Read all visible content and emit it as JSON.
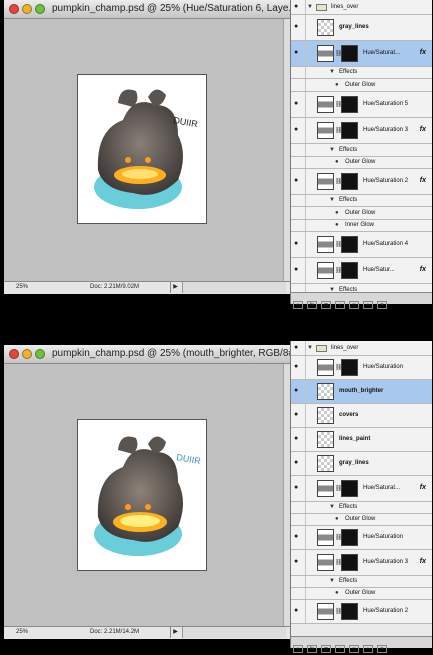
{
  "window1": {
    "title": "pumpkin_champ.psd @ 25% (Hue/Saturation 6, Laye...",
    "zoom": "25%",
    "doc_info": "Doc: 2.21M/9.02M",
    "sketch_text": "DUIIR"
  },
  "window2": {
    "title": "pumpkin_champ.psd @ 25% (mouth_brighter, RGB/8#)",
    "zoom": "25%",
    "doc_info": "Doc: 2.21M/14.2M",
    "sketch_text": "DUIIR"
  },
  "panel1": {
    "rows": [
      {
        "kind": "group",
        "name": "lines_over"
      },
      {
        "kind": "layer",
        "name": "gray_lines"
      },
      {
        "kind": "layer",
        "name": "Hue/Saturat...",
        "fx": "fx"
      },
      {
        "kind": "sub",
        "name": "Effects"
      },
      {
        "kind": "sub2",
        "name": "Outer Glow"
      },
      {
        "kind": "layer",
        "name": "Hue/Saturation 5"
      },
      {
        "kind": "layer",
        "name": "Hue/Saturation 3",
        "fx": "fx"
      },
      {
        "kind": "sub",
        "name": "Effects"
      },
      {
        "kind": "sub2",
        "name": "Outer Glow"
      },
      {
        "kind": "layer",
        "name": "Hue/Saturation 2",
        "fx": "fx"
      },
      {
        "kind": "sub",
        "name": "Effects"
      },
      {
        "kind": "sub2",
        "name": "Outer Glow"
      },
      {
        "kind": "sub2",
        "name": "Inner Glow"
      },
      {
        "kind": "layer",
        "name": "Hue/Saturation 4"
      },
      {
        "kind": "layer",
        "name": "Hue/Satur...",
        "fx": "fx"
      },
      {
        "kind": "sub",
        "name": "Effects"
      }
    ]
  },
  "panel2": {
    "rows": [
      {
        "kind": "group",
        "name": "lines_over"
      },
      {
        "kind": "layer",
        "name": "Hue/Saturation"
      },
      {
        "kind": "layer",
        "name": "mouth_brighter"
      },
      {
        "kind": "layer",
        "name": "covers"
      },
      {
        "kind": "layer",
        "name": "lines_paint"
      },
      {
        "kind": "layer",
        "name": "gray_lines"
      },
      {
        "kind": "layer",
        "name": "Hue/Saturat...",
        "fx": "fx"
      },
      {
        "kind": "sub",
        "name": "Effects"
      },
      {
        "kind": "sub2",
        "name": "Outer Glow"
      },
      {
        "kind": "layer",
        "name": "Hue/Saturation"
      },
      {
        "kind": "layer",
        "name": "Hue/Saturation 3",
        "fx": "fx"
      },
      {
        "kind": "sub",
        "name": "Effects"
      },
      {
        "kind": "sub2",
        "name": "Outer Glow"
      },
      {
        "kind": "layer",
        "name": "Hue/Saturation 2"
      }
    ]
  },
  "panel_buttons": [
    "link",
    "fx",
    "mask",
    "adj",
    "folder",
    "new",
    "trash"
  ]
}
